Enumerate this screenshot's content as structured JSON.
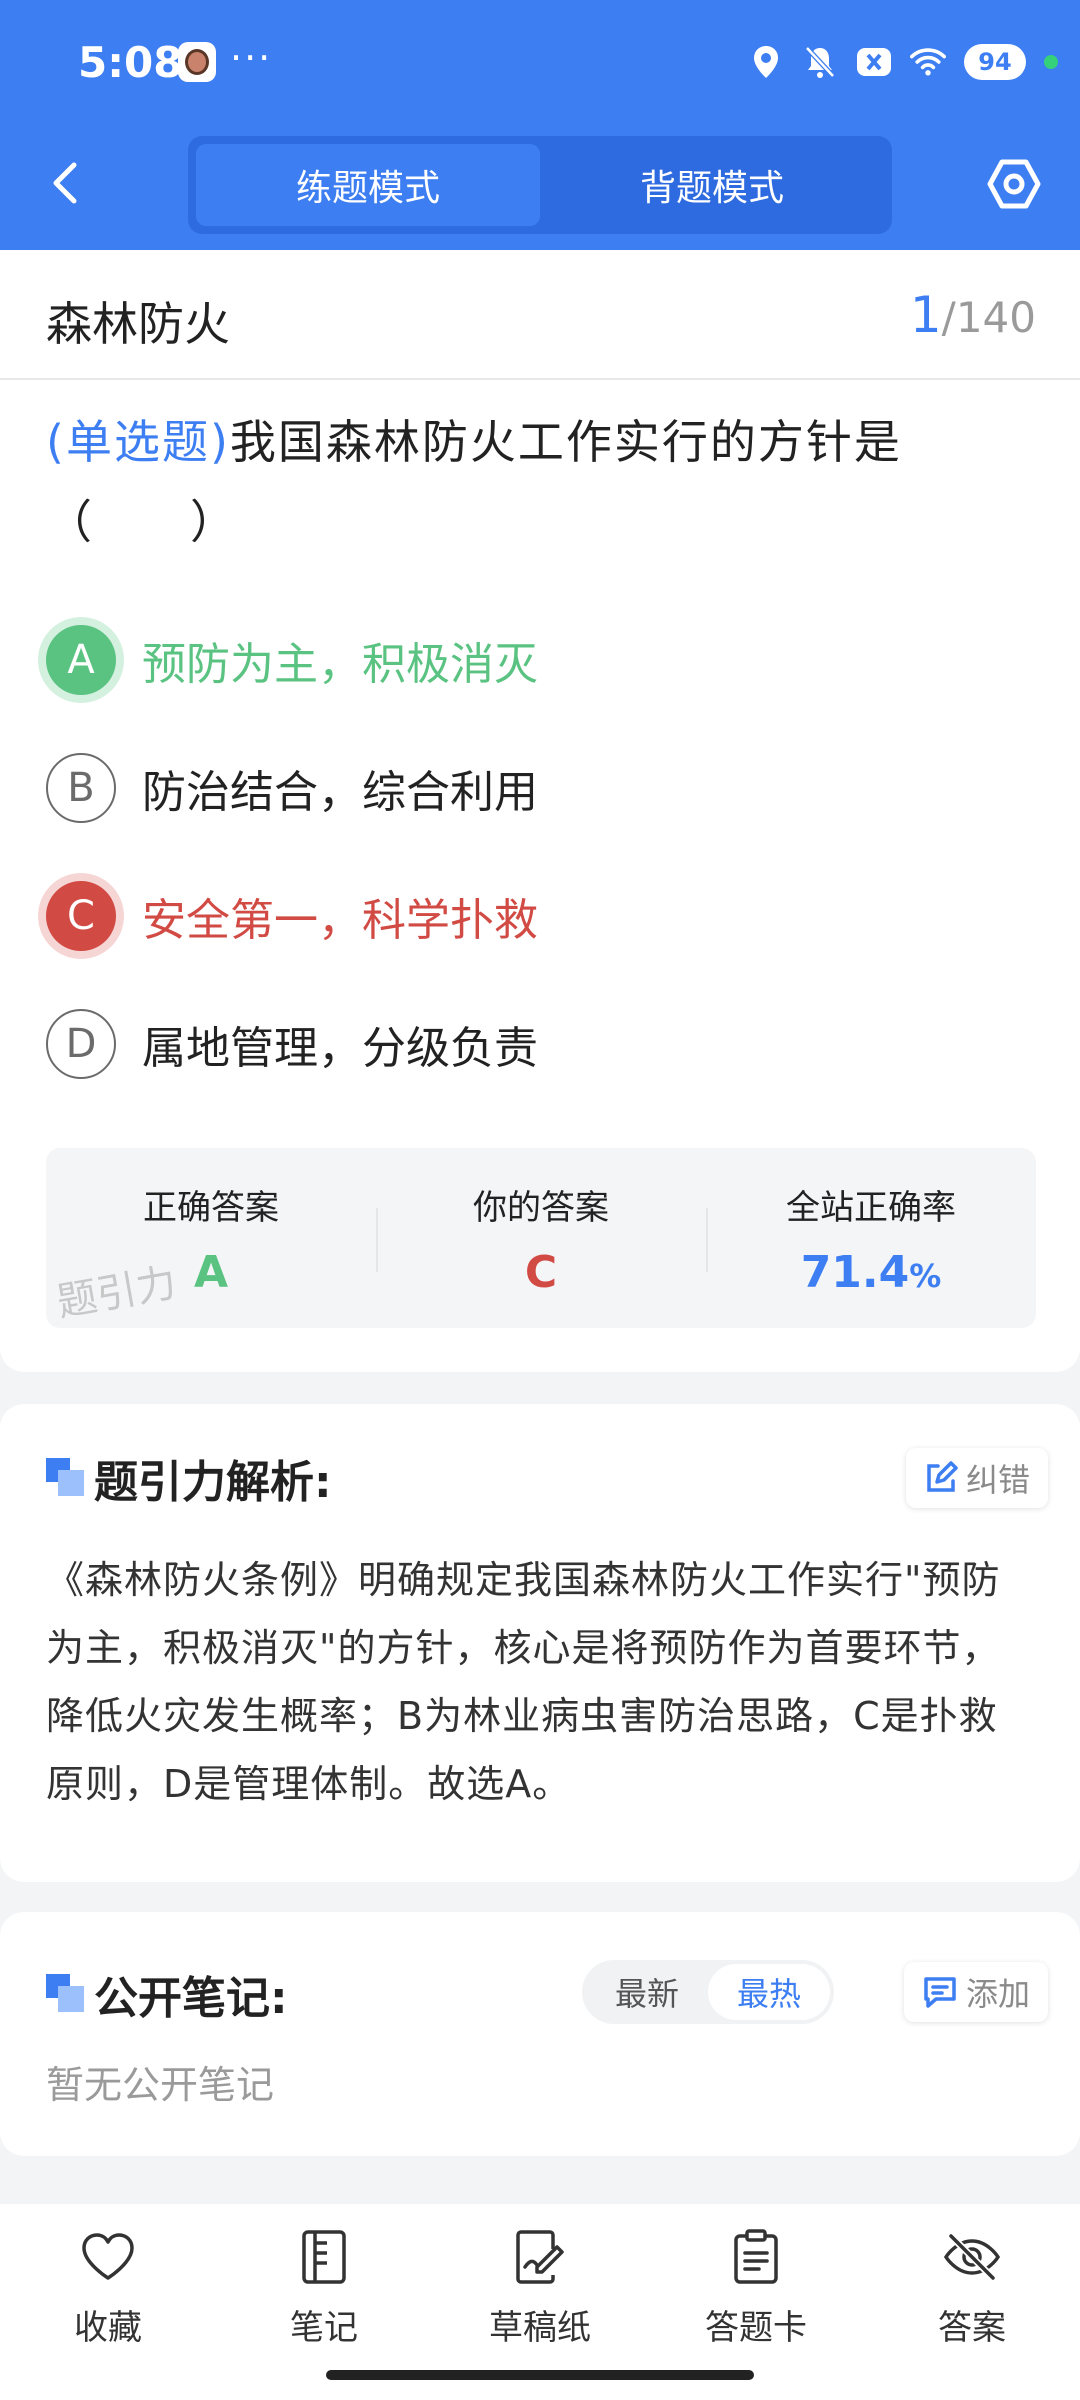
{
  "status_bar": {
    "time": "5:08",
    "more": "···",
    "battery": "94"
  },
  "header": {
    "tabs": [
      {
        "label": "练题模式",
        "active": true
      },
      {
        "label": "背题模式",
        "active": false
      }
    ]
  },
  "question": {
    "category": "森林防火",
    "current": "1",
    "total": "/140",
    "type_label": "(单选题)",
    "text": "我国森林防火工作实行的方针是（　　）",
    "options": [
      {
        "letter": "A",
        "text": "预防为主，积极消灭",
        "state": "correct"
      },
      {
        "letter": "B",
        "text": "防治结合，综合利用",
        "state": "normal"
      },
      {
        "letter": "C",
        "text": "安全第一，科学扑救",
        "state": "wrong"
      },
      {
        "letter": "D",
        "text": "属地管理，分级负责",
        "state": "normal"
      }
    ]
  },
  "stats": {
    "correct_label": "正确答案",
    "correct_value": "A",
    "yours_label": "你的答案",
    "yours_value": "C",
    "rate_label": "全站正确率",
    "rate_value": "71.4",
    "rate_unit": "%",
    "watermark": "题引力"
  },
  "analysis": {
    "title": "题引力解析:",
    "report_label": "纠错",
    "text": "《森林防火条例》明确规定我国森林防火工作实行\"预防为主，积极消灭\"的方针，核心是将预防作为首要环节，降低火灾发生概率；B为林业病虫害防治思路，C是扑救原则，D是管理体制。故选A。"
  },
  "notes": {
    "title": "公开笔记:",
    "sort_latest": "最新",
    "sort_hot": "最热",
    "add_label": "添加",
    "empty_text": "暂无公开笔记"
  },
  "bottom_nav": {
    "favorite": "收藏",
    "notes": "笔记",
    "scratch": "草稿纸",
    "answer_card": "答题卡",
    "answer": "答案"
  },
  "colors": {
    "primary": "#3d7ef2",
    "correct": "#5bc382",
    "wrong": "#d24a44"
  }
}
